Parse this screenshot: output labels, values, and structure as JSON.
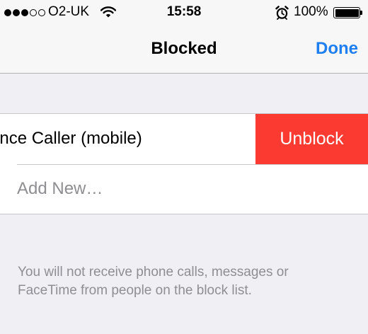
{
  "status_bar": {
    "signal_bars": 5,
    "signal_filled": 3,
    "carrier": "O2-UK",
    "wifi_icon": "wifi-icon",
    "time": "15:58",
    "alarm_icon": "alarm-clock-icon",
    "battery_percent": "100%",
    "battery_level": 1.0
  },
  "nav": {
    "title": "Blocked",
    "done_label": "Done"
  },
  "blocked_list": {
    "contact": "Nuisance Caller (mobile)",
    "unblock_label": "Unblock",
    "add_new_label": "Add New…"
  },
  "footer": {
    "note": "You will not receive phone calls, messages or FaceTime from people on the block list."
  },
  "colors": {
    "background": "#efeff4",
    "accent": "#1f7ff0",
    "destructive": "#fb3b31",
    "secondary_text": "#8e8e93"
  }
}
